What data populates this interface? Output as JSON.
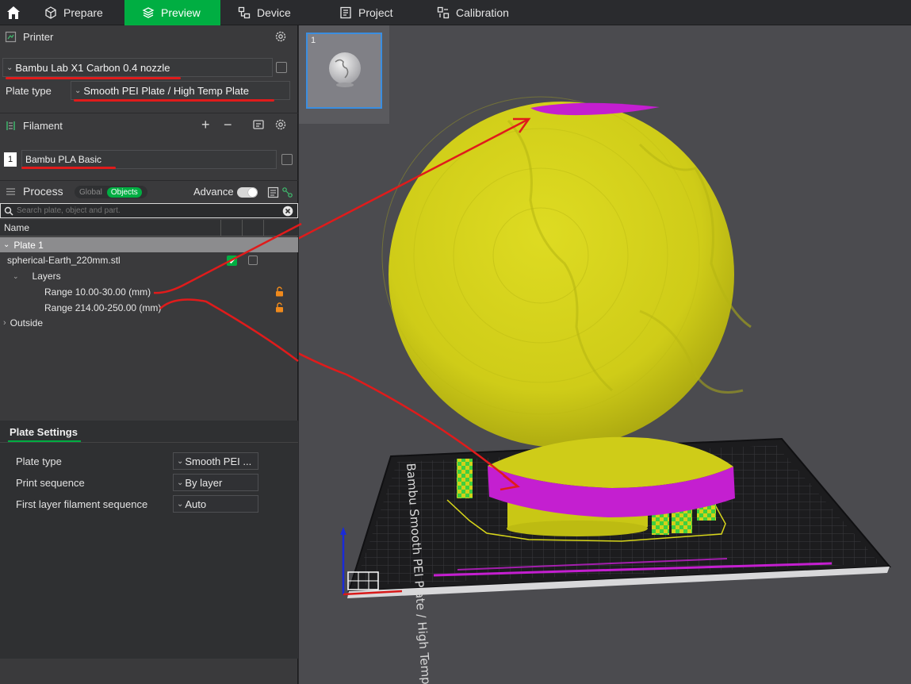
{
  "tabs": [
    {
      "label": "Prepare",
      "icon": "cube-icon"
    },
    {
      "label": "Preview",
      "icon": "layers-icon"
    },
    {
      "label": "Device",
      "icon": "device-icon"
    },
    {
      "label": "Project",
      "icon": "project-icon"
    },
    {
      "label": "Calibration",
      "icon": "calibration-icon"
    }
  ],
  "active_tab": "Preview",
  "printer": {
    "title": "Printer",
    "preset": "Bambu Lab X1 Carbon 0.4 nozzle",
    "plate_type_label": "Plate type",
    "plate_type": "Smooth PEI Plate / High Temp Plate"
  },
  "filament": {
    "title": "Filament",
    "slot_number": "1",
    "name": "Bambu PLA Basic"
  },
  "process": {
    "title": "Process",
    "global_label": "Global",
    "objects_label": "Objects",
    "advance_label": "Advance",
    "advance_on": true
  },
  "search": {
    "placeholder": "Search plate, object and part."
  },
  "object_list": {
    "column_name": "Name",
    "plate": "Plate 1",
    "object": "spherical-Earth_220mm.stl",
    "layers_label": "Layers",
    "ranges": [
      "Range 10.00-30.00 (mm)",
      "Range 214.00-250.00 (mm)"
    ],
    "outside": "Outside"
  },
  "plate_settings": {
    "title": "Plate Settings",
    "rows": [
      {
        "label": "Plate type",
        "value": "Smooth PEI ..."
      },
      {
        "label": "Print sequence",
        "value": "By layer"
      },
      {
        "label": "First layer filament sequence",
        "value": "Auto"
      }
    ]
  },
  "viewport": {
    "thumbnail_number": "1",
    "bed_label": "Bambu Smooth PEI Plate / High Temp Plate",
    "colors": {
      "model": "#d3d11a",
      "modifier": "#c41fd0",
      "support": "#3fcf3f",
      "bed": "#1c1c1e",
      "annotation": "#e01b1b",
      "accent": "#00ae42"
    }
  }
}
